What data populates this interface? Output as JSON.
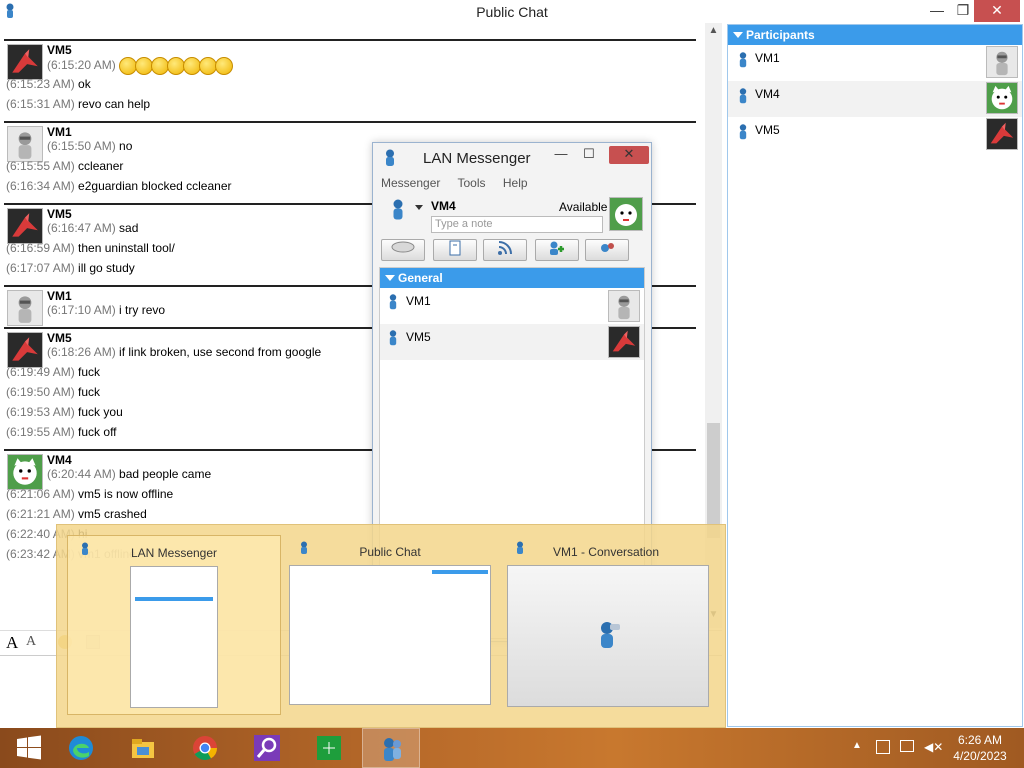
{
  "window": {
    "title": "Public Chat",
    "minimize": "—",
    "restore": "❐",
    "close": "✕"
  },
  "messages": [
    {
      "sender": "VM5",
      "avatar": "crane-avatar",
      "lines": [
        {
          "time": "(6:15:20 AM)",
          "text": "",
          "emoji_count": 7
        },
        {
          "time": "(6:15:23 AM)",
          "text": "ok"
        },
        {
          "time": "(6:15:31 AM)",
          "text": "revo can help"
        }
      ]
    },
    {
      "sender": "VM1",
      "avatar": "silver-figure-avatar",
      "lines": [
        {
          "time": "(6:15:50 AM)",
          "text": "no"
        },
        {
          "time": "(6:15:55 AM)",
          "text": "ccleaner"
        },
        {
          "time": "(6:16:34 AM)",
          "text": "e2guardian blocked ccleaner"
        }
      ]
    },
    {
      "sender": "VM5",
      "avatar": "crane-avatar",
      "lines": [
        {
          "time": "(6:16:47 AM)",
          "text": "sad"
        },
        {
          "time": "(6:16:59 AM)",
          "text": "then uninstall tool/"
        },
        {
          "time": "(6:17:07 AM)",
          "text": "ill go study"
        }
      ]
    },
    {
      "sender": "VM1",
      "avatar": "silver-figure-avatar",
      "lines": [
        {
          "time": "(6:17:10 AM)",
          "text": "i try revo"
        }
      ]
    },
    {
      "sender": "VM5",
      "avatar": "crane-avatar",
      "lines": [
        {
          "time": "(6:18:26 AM)",
          "text": "if link broken, use second from google"
        },
        {
          "time": "(6:19:49 AM)",
          "text": "fuck"
        },
        {
          "time": "(6:19:50 AM)",
          "text": "fuck"
        },
        {
          "time": "(6:19:53 AM)",
          "text": "fuck you"
        },
        {
          "time": "(6:19:55 AM)",
          "text": "fuck off"
        }
      ]
    },
    {
      "sender": "VM4",
      "avatar": "lucky-cat-avatar",
      "lines": [
        {
          "time": "(6:20:44 AM)",
          "text": "bad people came"
        },
        {
          "time": "(6:21:06 AM)",
          "text": "vm5 is now offline"
        },
        {
          "time": "(6:21:21 AM)",
          "text": "vm5 crashed"
        },
        {
          "time": "(6:22:40 AM)",
          "text": "hi"
        },
        {
          "time": "(6:23:42 AM)",
          "text": "vm1 offline"
        }
      ]
    }
  ],
  "participants": {
    "header": "Participants",
    "items": [
      {
        "name": "VM1",
        "avatar": "silver-figure-avatar"
      },
      {
        "name": "VM4",
        "avatar": "lucky-cat-avatar"
      },
      {
        "name": "VM5",
        "avatar": "crane-avatar"
      }
    ]
  },
  "lan_messenger": {
    "title": "LAN Messenger",
    "menu": [
      "Messenger",
      "Tools",
      "Help"
    ],
    "user": {
      "name": "VM4",
      "status": "Available",
      "note_placeholder": "Type a note"
    },
    "group": "General",
    "contacts": [
      {
        "name": "VM1",
        "avatar": "silver-figure-avatar"
      },
      {
        "name": "VM5",
        "avatar": "crane-avatar"
      }
    ],
    "toolbar_icons": [
      "message-icon",
      "file-transfer-icon",
      "broadcast-icon",
      "add-contact-icon",
      "settings-icon"
    ]
  },
  "thumbnails": [
    {
      "title": "LAN Messenger"
    },
    {
      "title": "Public Chat"
    },
    {
      "title": "VM1 - Conversation"
    }
  ],
  "taskbar": {
    "apps": [
      "start-icon",
      "edge-icon",
      "file-explorer-icon",
      "chrome-icon",
      "search-app-icon",
      "store-icon",
      "lan-messenger-icon"
    ],
    "time": "6:26 AM",
    "date": "4/20/2023"
  },
  "colors": {
    "accent": "#3b9bea",
    "close_red": "#c75050",
    "preview_bg": "#f3d68c",
    "taskbar": "#b86a2a"
  }
}
